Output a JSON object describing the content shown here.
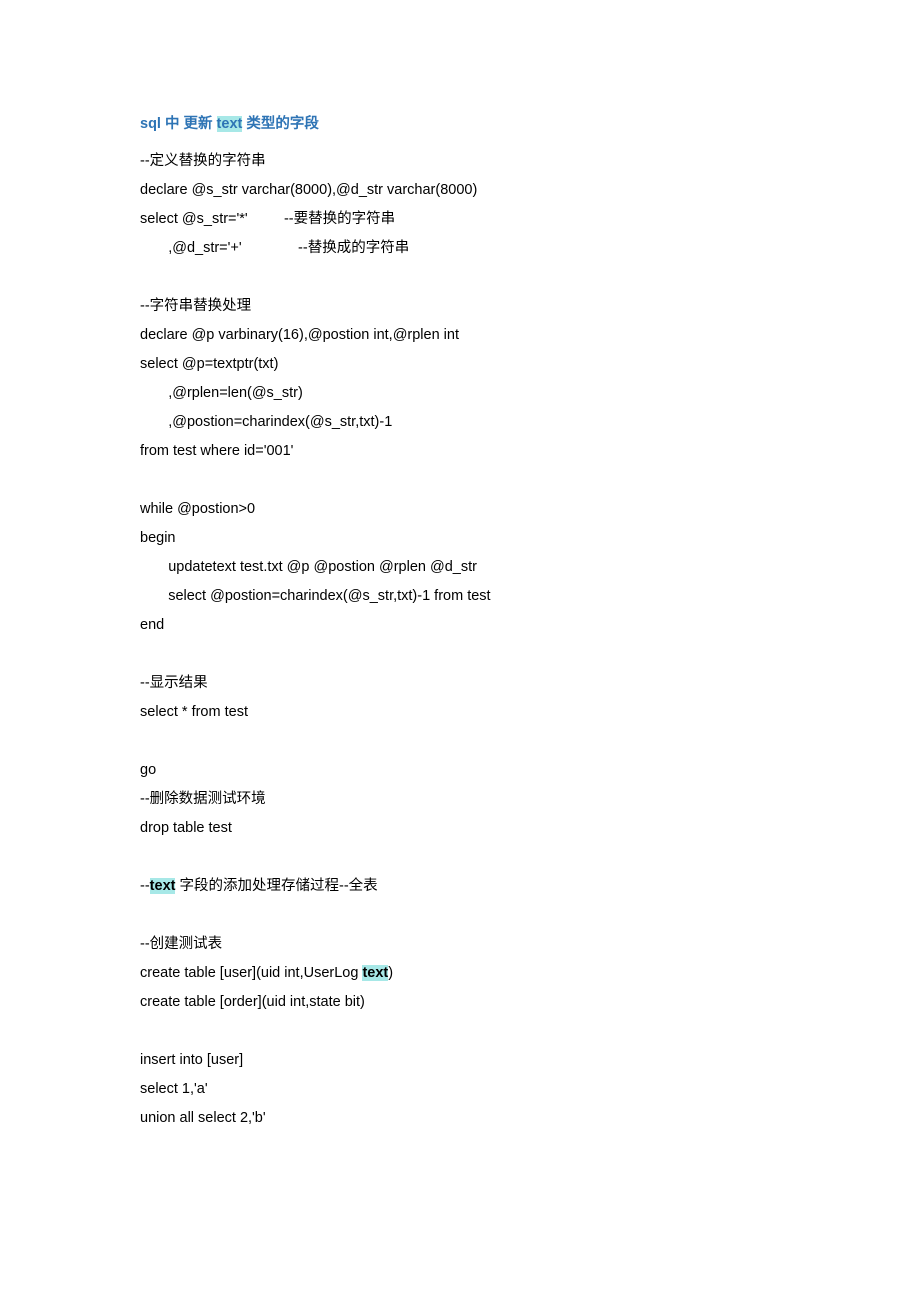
{
  "title_part1": "sql",
  "title_part2": " 中  更新 ",
  "title_hl": "text",
  "title_part3": " 类型的字段",
  "l1": "--定义替换的字符串",
  "l2": "declare @s_str varchar(8000),@d_str varchar(8000)",
  "l3": "select @s_str='*'         --要替换的字符串",
  "l4": "       ,@d_str='+'              --替换成的字符串",
  "l5": "--字符串替换处理",
  "l6": "declare @p varbinary(16),@postion int,@rplen int",
  "l7": "select @p=textptr(txt)",
  "l8": "       ,@rplen=len(@s_str)",
  "l9": "       ,@postion=charindex(@s_str,txt)-1",
  "l10": "from test where id='001'",
  "l11": "while @postion>0",
  "l12": "begin",
  "l13": "       updatetext test.txt @p @postion @rplen @d_str",
  "l14": "       select @postion=charindex(@s_str,txt)-1 from test",
  "l15": "end",
  "l16": "--显示结果",
  "l17": "select * from test",
  "l18": "go",
  "l19": "--删除数据测试环境",
  "l20": "drop table test",
  "l21a": "--",
  "l21b": "text",
  "l21c": " 字段的添加处理存储过程--全表",
  "l22": "--创建测试表",
  "l23a": "create table [user](uid int,UserLog ",
  "l23b": "text",
  "l23c": ")",
  "l24": "create table [order](uid int,state bit)",
  "l25": "insert into [user]",
  "l26": "select 1,'a'",
  "l27": "union all select 2,'b'"
}
